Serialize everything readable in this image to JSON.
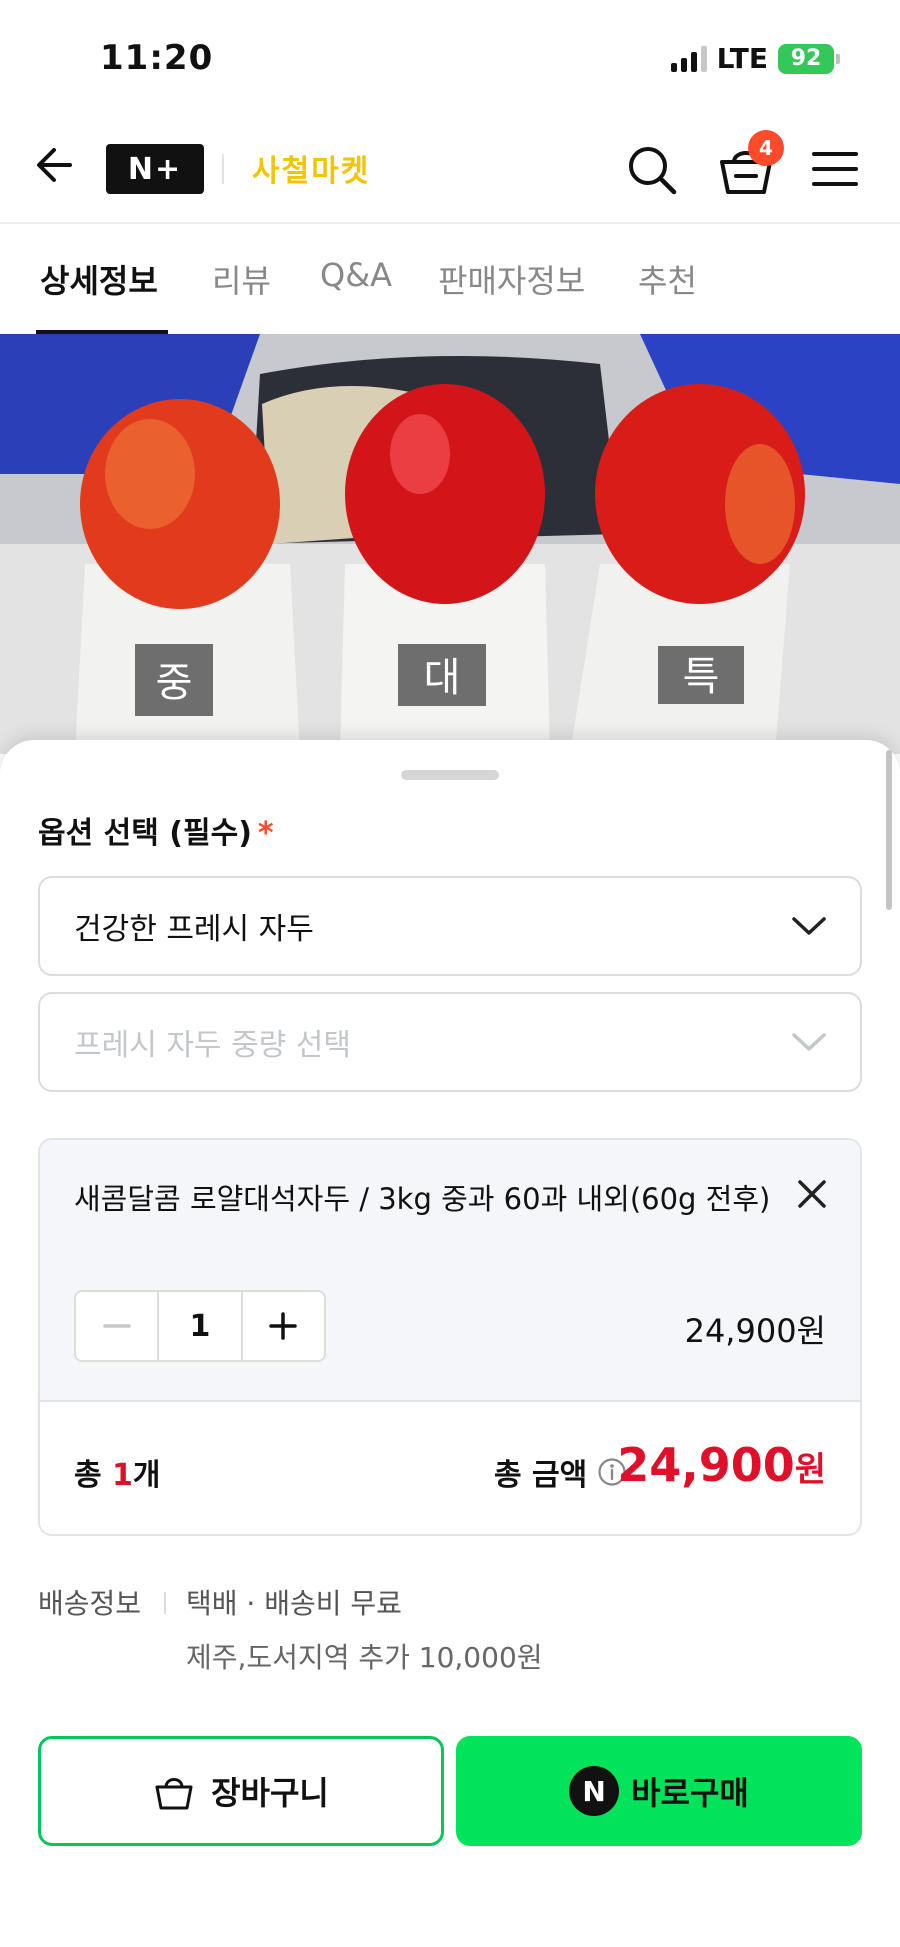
{
  "status_bar": {
    "time": "11:20",
    "network": "LTE",
    "battery": "92"
  },
  "header": {
    "logo": "N+",
    "store_name": "사철마켓",
    "cart_count": "4"
  },
  "tabs": [
    {
      "label": "상세정보",
      "active": true
    },
    {
      "label": "리뷰"
    },
    {
      "label": "Q&A"
    },
    {
      "label": "판매자정보"
    },
    {
      "label": "추천"
    }
  ],
  "hero": {
    "size_labels": [
      "중",
      "대",
      "특"
    ]
  },
  "options": {
    "title": "옵션 선택 (필수)",
    "required_mark": "*",
    "select_1_value": "건강한 프레시 자두",
    "select_2_placeholder": "프레시 자두 중량 선택"
  },
  "selected_item": {
    "name": "새콤달콤 로얄대석자두 / 3kg 중과 60과 내외(60g 전후)",
    "quantity": "1",
    "price": "24,900원"
  },
  "total": {
    "count_prefix": "총 ",
    "count": "1",
    "count_suffix": "개",
    "label": "총 금액",
    "amount": "24,900",
    "unit": "원"
  },
  "shipping": {
    "label": "배송정보",
    "value": "택배 · 배송비 무료",
    "extra": "제주,도서지역 추가 10,000원"
  },
  "buttons": {
    "cart": "장바구니",
    "buy": "바로구매",
    "npay_glyph": "N"
  },
  "colors": {
    "accent_green": "#03e25b",
    "price_red": "#e0102a",
    "brand_yellow": "#f2c500",
    "badge": "#ff4b2b"
  }
}
